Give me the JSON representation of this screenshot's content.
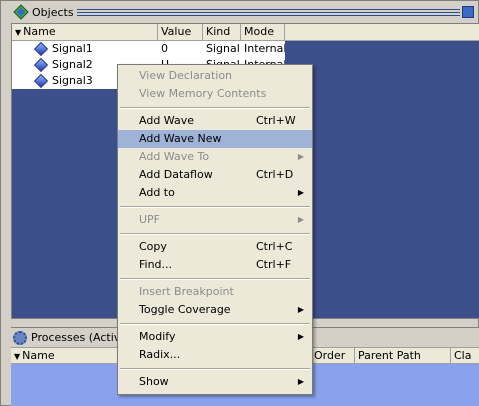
{
  "objects_window": {
    "title": "Objects",
    "columns": [
      "Name",
      "Value",
      "Kind",
      "Mode"
    ],
    "rows": [
      {
        "name": "Signal1",
        "value": "0",
        "kind": "Signal",
        "mode": "Internal"
      },
      {
        "name": "Signal2",
        "value": "U",
        "kind": "Signal",
        "mode": "Internal"
      },
      {
        "name": "Signal3",
        "value": "",
        "kind": "",
        "mode": ""
      }
    ]
  },
  "processes_window": {
    "title": "Processes (Active)",
    "columns": [
      "Name",
      "Order",
      "Parent Path",
      "Cla"
    ]
  },
  "context_menu": {
    "items": [
      {
        "label": "View Declaration",
        "shortcut": "",
        "submenu": false,
        "enabled": false
      },
      {
        "label": "View Memory Contents",
        "shortcut": "",
        "submenu": false,
        "enabled": false
      },
      {
        "label": "Add Wave",
        "shortcut": "Ctrl+W",
        "submenu": false,
        "enabled": true
      },
      {
        "label": "Add Wave New",
        "shortcut": "",
        "submenu": false,
        "enabled": true,
        "highlighted": true
      },
      {
        "label": "Add Wave To",
        "shortcut": "",
        "submenu": true,
        "enabled": false
      },
      {
        "label": "Add Dataflow",
        "shortcut": "Ctrl+D",
        "submenu": false,
        "enabled": true
      },
      {
        "label": "Add to",
        "shortcut": "",
        "submenu": true,
        "enabled": true
      },
      {
        "label": "UPF",
        "shortcut": "",
        "submenu": true,
        "enabled": false
      },
      {
        "label": "Copy",
        "shortcut": "Ctrl+C",
        "submenu": false,
        "enabled": true
      },
      {
        "label": "Find...",
        "shortcut": "Ctrl+F",
        "submenu": false,
        "enabled": true
      },
      {
        "label": "Insert Breakpoint",
        "shortcut": "",
        "submenu": false,
        "enabled": false
      },
      {
        "label": "Toggle Coverage",
        "shortcut": "",
        "submenu": true,
        "enabled": true
      },
      {
        "label": "Modify",
        "shortcut": "",
        "submenu": true,
        "enabled": true
      },
      {
        "label": "Radix...",
        "shortcut": "",
        "submenu": false,
        "enabled": true
      },
      {
        "label": "Show",
        "shortcut": "",
        "submenu": true,
        "enabled": true
      }
    ]
  },
  "icons": {
    "objects": "objects-window-icon",
    "signal": "signal-diamond-icon",
    "processes": "gear-icon",
    "submenu": "triangle-right-icon",
    "sort": "triangle-down-icon"
  },
  "colors": {
    "panel_bg": "#3d4f8a",
    "menu_bg": "#ece9d8",
    "menu_highlight": "#9fb3d6",
    "processes_bg": "#8aa2ee"
  }
}
